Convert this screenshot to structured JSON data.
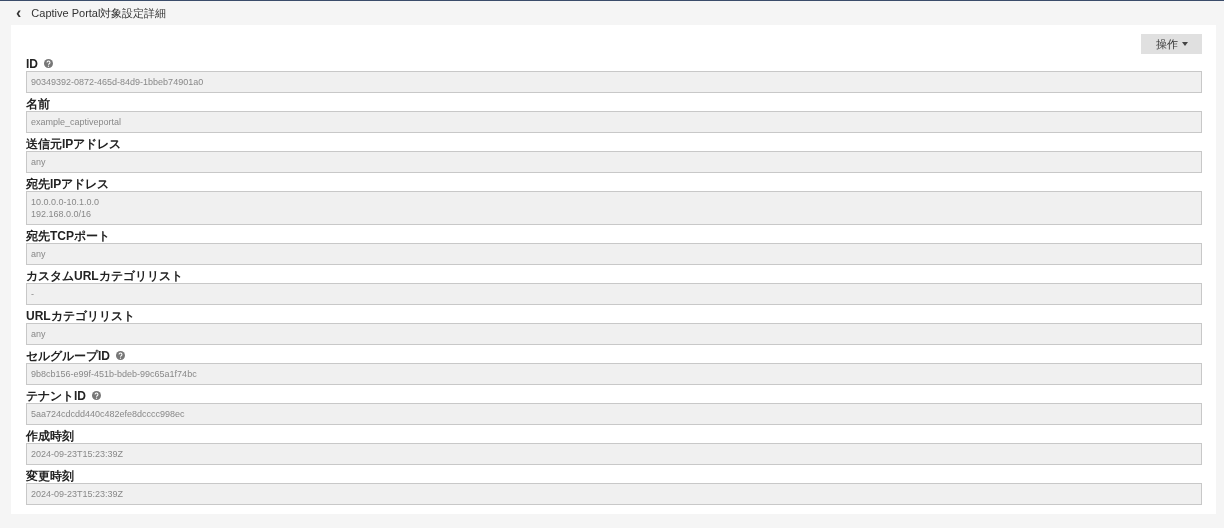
{
  "header": {
    "back": "‹",
    "title": "Captive Portal対象設定詳細"
  },
  "actions_button": {
    "label": "操作"
  },
  "fields": [
    {
      "label": "ID",
      "help": true,
      "lines": [
        "90349392-0872-465d-84d9-1bbeb74901a0"
      ]
    },
    {
      "label": "名前",
      "help": false,
      "lines": [
        "example_captiveportal"
      ]
    },
    {
      "label": "送信元IPアドレス",
      "help": false,
      "lines": [
        "any"
      ]
    },
    {
      "label": "宛先IPアドレス",
      "help": false,
      "lines": [
        "10.0.0.0-10.1.0.0",
        "192.168.0.0/16"
      ]
    },
    {
      "label": "宛先TCPポート",
      "help": false,
      "lines": [
        "any"
      ]
    },
    {
      "label": "カスタムURLカテゴリリスト",
      "help": false,
      "lines": [
        "-"
      ]
    },
    {
      "label": "URLカテゴリリスト",
      "help": false,
      "lines": [
        "any"
      ]
    },
    {
      "label": "セルグループID",
      "help": true,
      "lines": [
        "9b8cb156-e99f-451b-bdeb-99c65a1f74bc"
      ]
    },
    {
      "label": "テナントID",
      "help": true,
      "lines": [
        "5aa724cdcdd440c482efe8dcccc998ec"
      ]
    },
    {
      "label": "作成時刻",
      "help": false,
      "lines": [
        "2024-09-23T15:23:39Z"
      ]
    },
    {
      "label": "変更時刻",
      "help": false,
      "lines": [
        "2024-09-23T15:23:39Z"
      ]
    }
  ]
}
